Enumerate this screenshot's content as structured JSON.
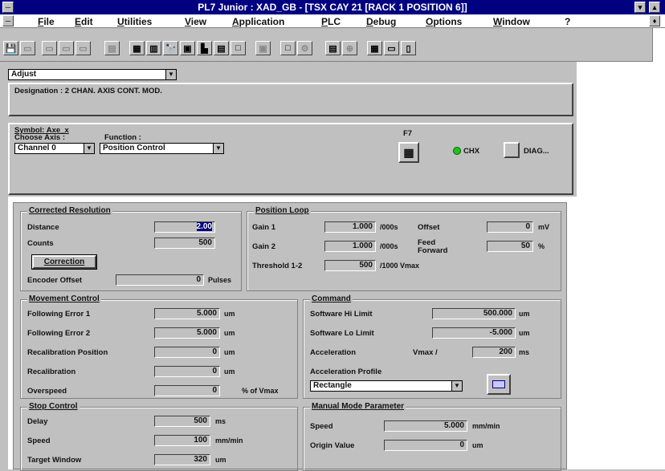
{
  "window": {
    "title": "PL7 Junior : XAD_GB - [TSX CAY 21 [RACK 1    POSITION 6]]",
    "minimize": "▾",
    "maximize": "▴"
  },
  "menu": [
    "File",
    "Edit",
    "Utilities",
    "View",
    "Application",
    "PLC",
    "Debug",
    "Options",
    "Window",
    "?"
  ],
  "toolbar": [
    "💾",
    "▭",
    "▭",
    "▭",
    "▭",
    "▤",
    "▦",
    "▥",
    "🔭",
    "▣",
    "▙",
    "▤",
    "□",
    "▣",
    "□",
    "⚙",
    "▤",
    "⊕",
    "▦",
    "▭",
    "▯"
  ],
  "mode_select": {
    "value": "Adjust"
  },
  "designation": {
    "label": "Designation : 2 CHAN. AXIS CONT. MOD."
  },
  "symbol": {
    "label": "Symbol: Axe_x",
    "choose_axis_label": "Choose Axis :",
    "function_label": "Function :",
    "channel_value": "Channel 0",
    "function_value": "Position Control",
    "f7_label": "F7",
    "chx_label": "CHX",
    "diag_label": "DIAG..."
  },
  "corrected_resolution": {
    "title": "Corrected Resolution",
    "distance_label": "Distance",
    "distance_value": "2.00",
    "counts_label": "Counts",
    "counts_value": "500",
    "correction_button": "Correction",
    "encoder_offset_label": "Encoder Offset",
    "encoder_offset_value": "0",
    "encoder_offset_unit": "Pulses"
  },
  "position_loop": {
    "title": "Position Loop",
    "gain1_label": "Gain 1",
    "gain1_value": "1.000",
    "gain1_unit": "/000s",
    "gain2_label": "Gain 2",
    "gain2_value": "1.000",
    "gain2_unit": "/000s",
    "threshold_label": "Threshold 1-2",
    "threshold_value": "500",
    "threshold_unit": "/1000 Vmax",
    "offset_label": "Offset",
    "offset_value": "0",
    "offset_unit": "mV",
    "ff_label": "Feed Forward",
    "ff_value": "50",
    "ff_unit": "%"
  },
  "movement_control": {
    "title": "Movement Control",
    "fe1_label": "Following Error 1",
    "fe1_value": "5.000",
    "fe1_unit": "um",
    "fe2_label": "Following Error 2",
    "fe2_value": "5.000",
    "fe2_unit": "um",
    "recal_pos_label": "Recalibration Position",
    "recal_pos_value": "0",
    "recal_pos_unit": "um",
    "recal_label": "Recalibration",
    "recal_value": "0",
    "recal_unit": "um",
    "overspeed_label": "Overspeed",
    "overspeed_value": "0",
    "overspeed_unit": "% of Vmax"
  },
  "command": {
    "title": "Command",
    "hi_label": "Software Hi Limit",
    "hi_value": "500.000",
    "hi_unit": "um",
    "lo_label": "Software Lo Limit",
    "lo_value": "-5.000",
    "lo_unit": "um",
    "acc_label": "Acceleration",
    "vmax_label": "Vmax /",
    "acc_value": "200",
    "acc_unit": "ms",
    "profile_label": "Acceleration Profile",
    "profile_value": "Rectangle"
  },
  "stop_control": {
    "title": "Stop Control",
    "delay_label": "Delay",
    "delay_value": "500",
    "delay_unit": "ms",
    "speed_label": "Speed",
    "speed_value": "100",
    "speed_unit": "mm/min",
    "target_label": "Target Window",
    "target_value": "320",
    "target_unit": "um"
  },
  "manual_mode": {
    "title": "Manual Mode Parameter",
    "speed_label": "Speed",
    "speed_value": "5.000",
    "speed_unit": "mm/min",
    "origin_label": "Origin Value",
    "origin_value": "0",
    "origin_unit": "um"
  }
}
